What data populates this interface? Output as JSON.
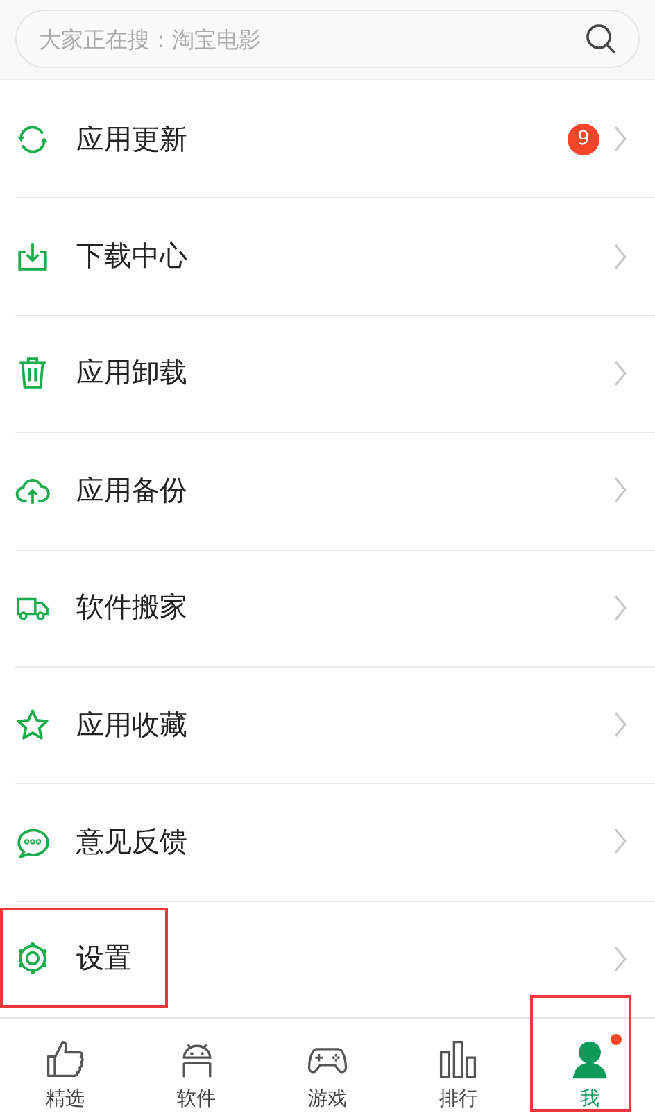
{
  "search": {
    "placeholder": "大家正在搜：淘宝电影"
  },
  "menu": [
    {
      "label": "应用更新",
      "badge": "9",
      "highlighted": false
    },
    {
      "label": "下载中心",
      "highlighted": false
    },
    {
      "label": "应用卸载",
      "highlighted": false
    },
    {
      "label": "应用备份",
      "highlighted": false
    },
    {
      "label": "软件搬家",
      "highlighted": false
    },
    {
      "label": "应用收藏",
      "highlighted": false
    },
    {
      "label": "意见反馈",
      "highlighted": false
    },
    {
      "label": "设置",
      "highlighted": true
    }
  ],
  "tabs": [
    {
      "label": "精选",
      "selected": false,
      "dot": false,
      "highlighted": false
    },
    {
      "label": "软件",
      "selected": false,
      "dot": false,
      "highlighted": false
    },
    {
      "label": "游戏",
      "selected": false,
      "dot": false,
      "highlighted": false
    },
    {
      "label": "排行",
      "selected": false,
      "dot": false,
      "highlighted": false
    },
    {
      "label": "我",
      "selected": true,
      "dot": true,
      "highlighted": true
    }
  ]
}
